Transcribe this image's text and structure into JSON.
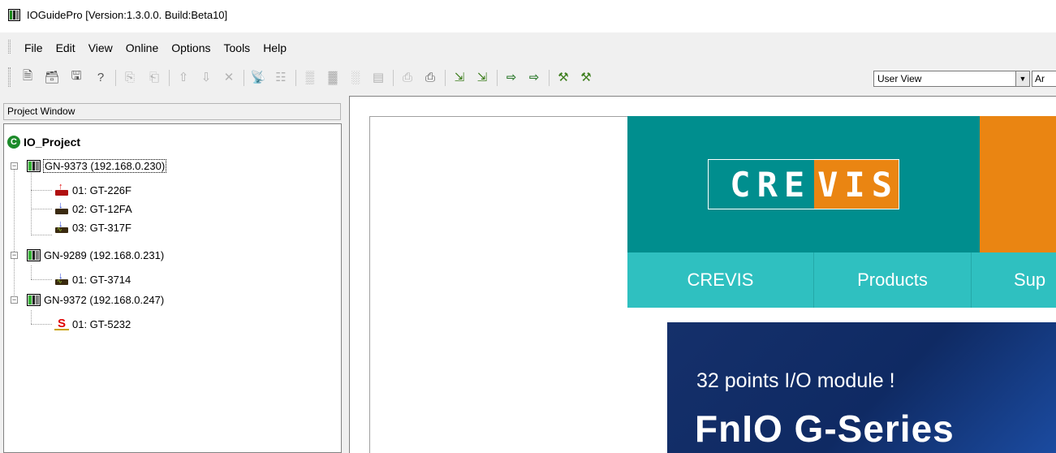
{
  "window": {
    "title": "IOGuidePro  [Version:1.3.0.0. Build:Beta10]"
  },
  "menu": {
    "items": [
      "File",
      "Edit",
      "View",
      "Online",
      "Options",
      "Tools",
      "Help"
    ]
  },
  "toolbar": {
    "icons": [
      "new-project-icon",
      "open-project-icon",
      "save-project-icon",
      "help-icon",
      "add-device-icon",
      "copy-device-icon",
      "move-up-icon",
      "move-down-icon",
      "delete-icon",
      "scan-network-icon",
      "properties-icon",
      "io-config-icon",
      "io-read-icon",
      "io-write-icon",
      "io-monitor-icon",
      "upload-icon",
      "download-icon",
      "connect-icon",
      "disconnect-icon",
      "send-icon",
      "receive-icon",
      "firmware-icon",
      "firmware-update-icon"
    ],
    "view_select": "User View",
    "lang_select": "Ar"
  },
  "project": {
    "header": "Project Window",
    "root": "IO_Project",
    "gateways": [
      {
        "label": "GN-9373 (192.168.0.230)",
        "modules": [
          "01: GT-226F",
          "02: GT-12FA",
          "03: GT-317F"
        ]
      },
      {
        "label": "GN-9289 (192.168.0.231)",
        "modules": [
          "01: GT-3714"
        ]
      },
      {
        "label": "GN-9372 (192.168.0.247)",
        "modules": [
          "01: GT-5232"
        ]
      }
    ]
  },
  "web": {
    "logo_left": "CRE",
    "logo_right": "VIS",
    "nav": [
      "CREVIS",
      "Products",
      "Sup"
    ],
    "banner_sub": "32 points I/O module !",
    "banner_title": "FnIO G-Series"
  }
}
